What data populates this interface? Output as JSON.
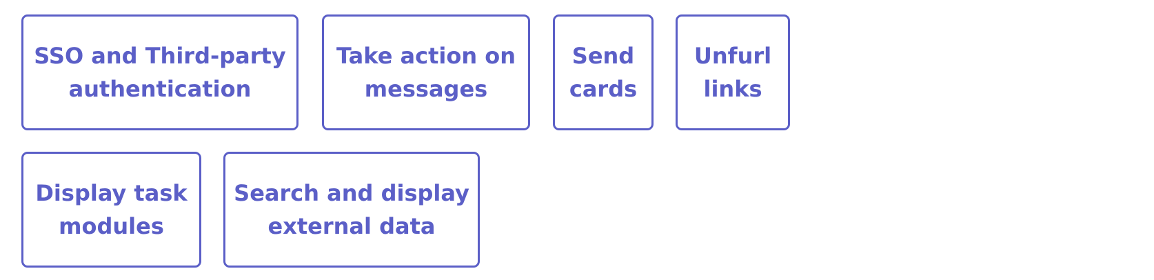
{
  "accent_color": "#5b5fc7",
  "capabilities": [
    {
      "lines": [
        "SSO and Third-party",
        "authentication"
      ]
    },
    {
      "lines": [
        "Take action on",
        "messages"
      ]
    },
    {
      "lines": [
        "Send",
        "cards"
      ]
    },
    {
      "lines": [
        "Unfurl",
        "links"
      ]
    },
    {
      "lines": [
        "Display task",
        "modules"
      ]
    },
    {
      "lines": [
        "Search and display",
        "external data"
      ]
    }
  ]
}
